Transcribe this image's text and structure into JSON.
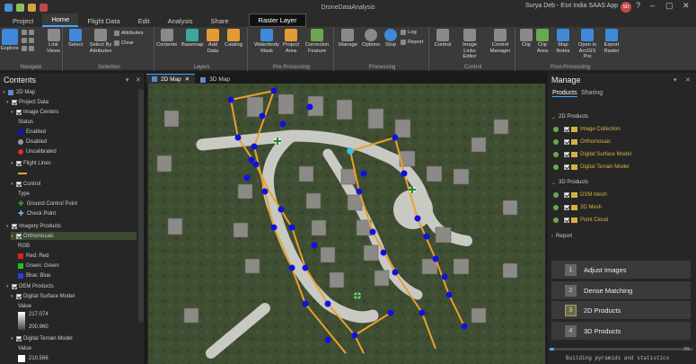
{
  "window": {
    "title": "DroneDataAnalysis",
    "user": "Surya Deb - Esri India SAAS App",
    "avatar": "SD"
  },
  "tabs": [
    "Project",
    "Home",
    "Flight Data",
    "Edit",
    "Analysis",
    "Share"
  ],
  "context_tab": "Raster Layer",
  "ribbon": {
    "navigate": {
      "label": "Navigate",
      "explore": "Explore",
      "link_views": "Link Views"
    },
    "selection": {
      "label": "Selection",
      "select": "Select",
      "select_by_attributes": "Select By Attributes",
      "attributes": "Attributes",
      "clear": "Clear"
    },
    "layers": {
      "label": "Layers",
      "contents": "Contents",
      "basemap": "Basemap",
      "add_data": "Add Data",
      "catalog": "Catalog"
    },
    "preprocessing": {
      "label": "Pre-Processing",
      "waterbody_mask": "Waterbody Mask",
      "project_area": "Project Area",
      "correction_feature": "Correction Feature"
    },
    "processing": {
      "label": "Processing",
      "manage": "Manage",
      "options": "Options",
      "stop": "Stop",
      "log": "Log",
      "report": "Report"
    },
    "control": {
      "label": "Control",
      "control": "Control",
      "image_links_editor": "Image Links Editor",
      "control_manager": "Control Manager"
    },
    "postprocessing": {
      "label": "Post-Processing",
      "clip": "Clip",
      "clip_area": "Clip Area",
      "map_notes": "Map Notes",
      "open_in_arcgis": "Open in ArcGIS Pro",
      "export_raster": "Export Raster"
    }
  },
  "contents": {
    "title": "Contents",
    "items": {
      "map": "2D Map",
      "project_data": "Project Data",
      "image_centers": "Image Centers",
      "status": "Status",
      "enabled": "Enabled",
      "disabled": "Disabled",
      "uncalibrated": "Uncalibrated",
      "flight_lines": "Flight Lines",
      "control": "Control",
      "type": "Type",
      "gcp": "Ground Control Point",
      "check_point": "Check Point",
      "imagery_products": "Imagery Products",
      "orthomosaic": "Orthomosaic",
      "rgb": "RGB",
      "red": "Red:   Red",
      "green": "Green: Green",
      "blue": "Blue:  Blue",
      "dem_products": "DEM Products",
      "dsm": "Digital Surface Model",
      "value": "Value",
      "dsm_high": "217.074",
      "dsm_low": "200.960",
      "dtm": "Digital Terrain Model",
      "value2": "Value",
      "dtm_high": "210.566"
    }
  },
  "map": {
    "tabs": [
      "2D Map",
      "3D Map"
    ]
  },
  "manage": {
    "title": "Manage",
    "tabs": [
      "Products",
      "Sharing"
    ],
    "sections": {
      "products2d": "2D Products",
      "products3d": "3D Products",
      "report": "Report"
    },
    "items2d": [
      "Image Collection",
      "Orthomosaic",
      "Digital Surface Model",
      "Digital Terrain Model"
    ],
    "items3d": [
      "DSM Mesh",
      "3D Mesh",
      "Point Cloud"
    ],
    "steps": [
      {
        "num": "1",
        "label": "Adjust Images"
      },
      {
        "num": "2",
        "label": "Dense Matching"
      },
      {
        "num": "3",
        "label": "2D Products"
      },
      {
        "num": "4",
        "label": "3D Products"
      }
    ],
    "progress_pct": 3,
    "progress_label": "3%",
    "status": "Building pyramids and statistics"
  },
  "colors": {
    "accent": "#4aa3ff",
    "flightline": "#e8a030",
    "enabled": "#1010e0",
    "gcp": "#2ea82e"
  }
}
